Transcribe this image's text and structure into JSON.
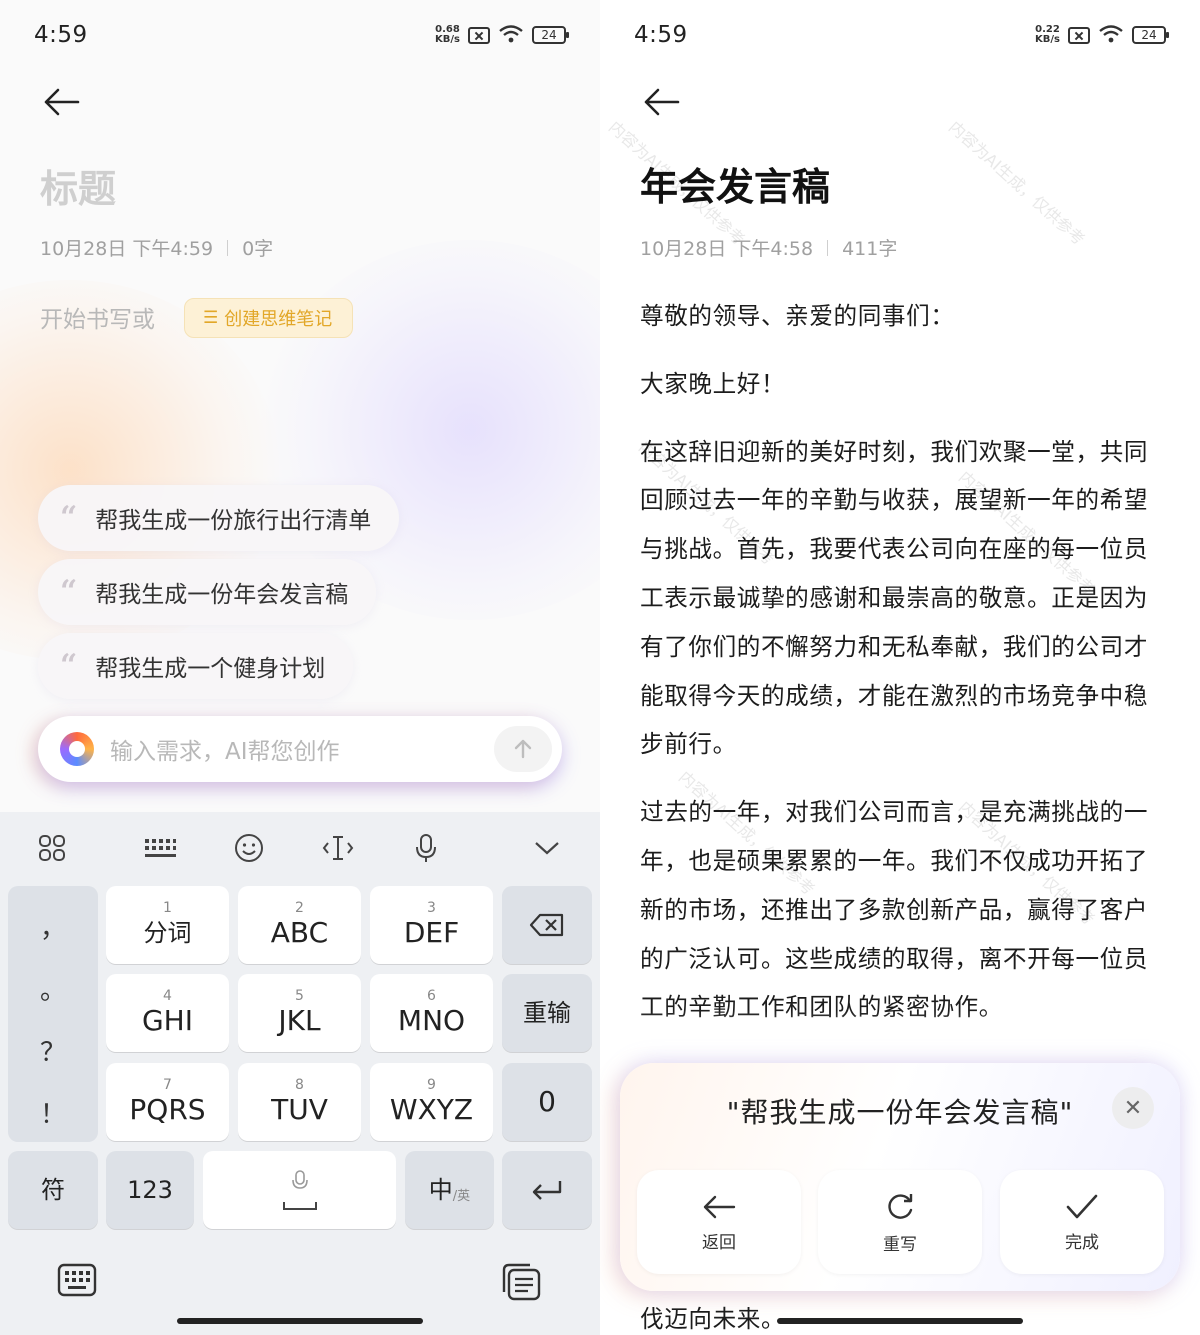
{
  "left": {
    "status": {
      "time": "4:59",
      "speed_value": "0.68",
      "speed_unit": "KB/s",
      "battery": "24"
    },
    "note": {
      "title_placeholder": "标题",
      "date": "10月28日 下午4:59",
      "word_count": "0字"
    },
    "start_hint": "开始书写或",
    "mindmap_button": "创建思维笔记",
    "suggestions": [
      "帮我生成一份旅行出行清单",
      "帮我生成一份年会发言稿",
      "帮我生成一个健身计划"
    ],
    "ai_input": {
      "placeholder": "输入需求，AI帮您创作"
    },
    "keyboard": {
      "punctuation": [
        "，",
        "。",
        "？",
        "！"
      ],
      "keys": [
        {
          "num": "1",
          "main": "分词"
        },
        {
          "num": "2",
          "main": "ABC"
        },
        {
          "num": "3",
          "main": "DEF"
        },
        {
          "num": "4",
          "main": "GHI"
        },
        {
          "num": "5",
          "main": "JKL"
        },
        {
          "num": "6",
          "main": "MNO"
        },
        {
          "num": "7",
          "main": "PQRS"
        },
        {
          "num": "8",
          "main": "TUV"
        },
        {
          "num": "9",
          "main": "WXYZ"
        }
      ],
      "reinput": "重输",
      "zero": "0",
      "symbol": "符",
      "numeric": "123",
      "lang_main": "中",
      "lang_sub": "/英"
    }
  },
  "right": {
    "status": {
      "time": "4:59",
      "speed_value": "0.22",
      "speed_unit": "KB/s",
      "battery": "24"
    },
    "doc": {
      "title": "年会发言稿",
      "date": "10月28日 下午4:58",
      "word_count": "411字",
      "paragraphs": [
        "尊敬的领导、亲爱的同事们：",
        "大家晚上好！",
        "在这辞旧迎新的美好时刻，我们欢聚一堂，共同回顾过去一年的辛勤与收获，展望新一年的希望与挑战。首先，我要代表公司向在座的每一位员工表示最诚挚的感谢和最崇高的敬意。正是因为有了你们的不懈努力和无私奉献，我们的公司才能取得今天的成绩，才能在激烈的市场竞争中稳步前行。",
        "过去的一年，对我们公司而言，是充满挑战的一年，也是硕果累累的一年。我们不仅成功开拓了新的市场，还推出了多款创新产品，赢得了客户的广泛认可。这些成绩的取得，离不开每一位员工的辛勤工作和团队的紧密协作。"
      ],
      "tail": "伐迈向未来。",
      "watermark": "内容为AI生成，仅供参考"
    },
    "ai_card": {
      "prompt": "\"帮我生成一份年会发言稿\"",
      "back": "返回",
      "rewrite": "重写",
      "done": "完成"
    }
  }
}
